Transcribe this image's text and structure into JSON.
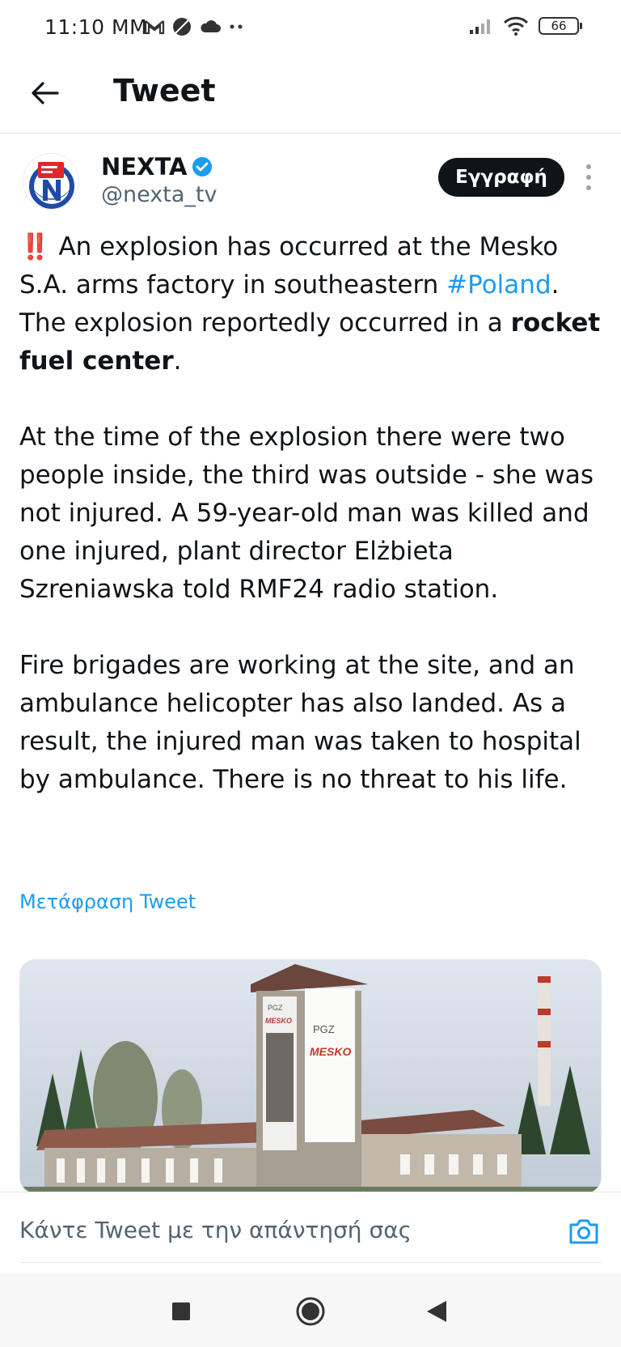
{
  "status_bar": {
    "time": "11:10 MM",
    "battery": "66",
    "icons": [
      "gmail-icon",
      "do-not-disturb-icon",
      "cloud-icon",
      "more-dots-icon",
      "signal-icon",
      "wifi-icon",
      "battery-icon"
    ]
  },
  "header": {
    "title": "Tweet",
    "back_icon": "arrow-left-icon"
  },
  "author": {
    "name": "NEXTA",
    "handle": "@nexta_tv",
    "verified": true,
    "subscribe_label": "Εγγραφή"
  },
  "tweet": {
    "p1_emoji": "‼️",
    "p1_a": " An explosion has occurred at the Mesko S.A. arms factory in southeastern ",
    "p1_hashtag": "#Poland",
    "p1_b": ". The explosion reportedly occurred in a ",
    "p1_bold": "rocket fuel center",
    "p1_c": ".",
    "p2": "At the time of the explosion there were two people inside, the third was outside - she was not injured. A 59-year-old man was killed and one injured, plant director Elżbieta Szreniawska told RMF24 radio station.",
    "p3": "Fire brigades are working at the site, and an ambulance helicopter has also landed. As a result, the injured man was taken to hospital by ambulance. There is no threat to his life.",
    "translate_label": "Μετάφραση Tweet"
  },
  "media": {
    "banner_brand_1": "PGZ",
    "banner_brand_2": "MESKO"
  },
  "reply": {
    "placeholder": "Κάντε Tweet με την απάντησή σας"
  },
  "colors": {
    "accent": "#1d9bf0",
    "text": "#0f1419",
    "muted": "#536471",
    "button_dark": "#0f1419"
  }
}
